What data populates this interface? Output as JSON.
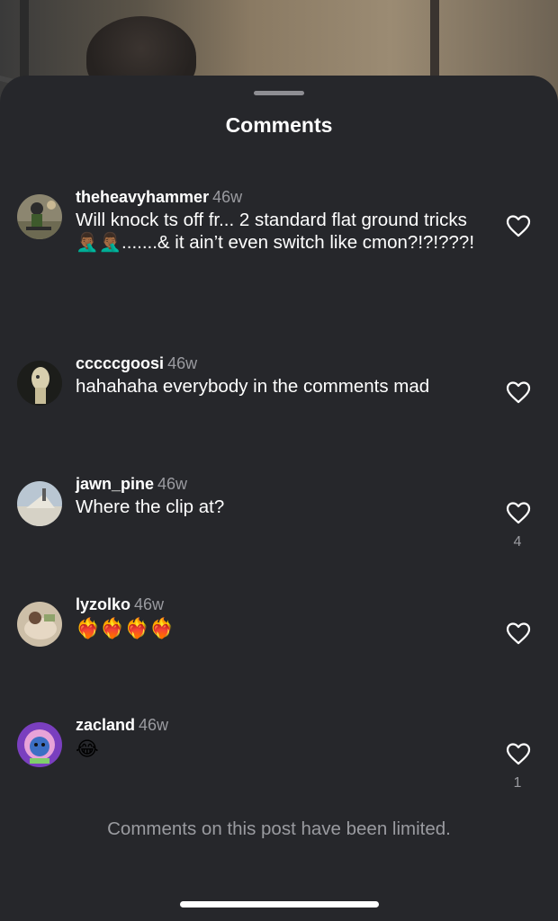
{
  "sheet": {
    "title": "Comments",
    "limited_notice": "Comments on this post have been limited."
  },
  "comments": [
    {
      "username": "theheavyhammer",
      "time": "46w",
      "text": "Will knock ts off fr... 2 standard flat ground tricks🤦🏾‍♂️🤦🏾‍♂️.......& it ain’t even switch like cmon?!?!???!",
      "likes": null
    },
    {
      "username": "cccccgoosi",
      "time": "46w",
      "text": "hahahaha everybody in the comments mad",
      "likes": null
    },
    {
      "username": "jawn_pine",
      "time": "46w",
      "text": "Where the clip at?",
      "likes": "4"
    },
    {
      "username": "lyzolko",
      "time": "46w",
      "text": "❤️‍🔥❤️‍🔥❤️‍🔥❤️‍🔥",
      "likes": null
    },
    {
      "username": "zacland",
      "time": "46w",
      "text": "😂",
      "likes": "1"
    }
  ],
  "icons": {
    "like": "heart-outline-icon",
    "grabber": "sheet-grabber"
  },
  "colors": {
    "sheet_background": "#26272b",
    "text_primary": "#ffffff",
    "text_secondary": "#9a9ba0"
  }
}
